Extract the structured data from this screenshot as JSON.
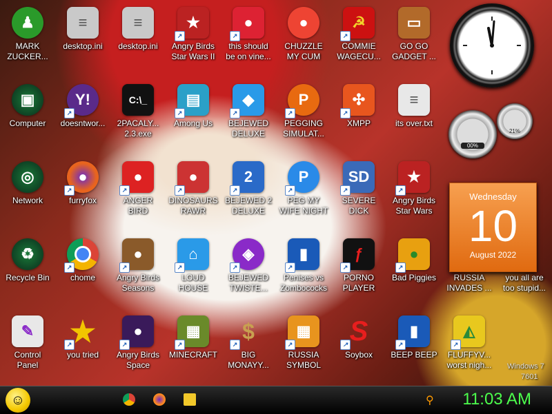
{
  "desktop": {
    "icons": [
      {
        "label": "MARK\nZUCKER...",
        "icon": "green-pawn-icon",
        "color": "#2a9a2a"
      },
      {
        "label": "desktop.ini",
        "icon": "document-icon",
        "color": "#c9c9c9"
      },
      {
        "label": "desktop.ini",
        "icon": "document-icon",
        "color": "#c9c9c9"
      },
      {
        "label": "Angry Birds\nStar Wars II",
        "icon": "angry-bird-icon",
        "color": "#b22"
      },
      {
        "label": "this should\nbe on vine...",
        "icon": "angry-bird-icon",
        "color": "#d23"
      },
      {
        "label": "CHUZZLE\nMY CUM",
        "icon": "chuzzle-icon",
        "color": "#e43"
      },
      {
        "label": "COMMIE\nWAGECU...",
        "icon": "hammer-sickle-icon",
        "color": "#c11"
      },
      {
        "label": "GO GO\nGADGET ...",
        "icon": "briefcase-icon",
        "color": "#b26a2a"
      },
      {
        "label": "Computer",
        "icon": "computer-icon",
        "color": "#135"
      },
      {
        "label": "doesntwor...",
        "icon": "yahoo-icon",
        "color": "#5a2a8a"
      },
      {
        "label": "2PACALY...\n2.3.exe",
        "icon": "console-icon",
        "color": "#111"
      },
      {
        "label": "Among Us",
        "icon": "among-us-icon",
        "color": "#2aa0c8"
      },
      {
        "label": "BEJEWED\nDELUXE",
        "icon": "gem-icon",
        "color": "#2a9ae8"
      },
      {
        "label": "PEGGING\nSIMULAT...",
        "icon": "peggle-icon",
        "color": "#e86a10"
      },
      {
        "label": "XMPP",
        "icon": "xmpp-icon",
        "color": "#e8561e"
      },
      {
        "label": "its over.txt",
        "icon": "text-file-icon",
        "color": "#e8e8e8"
      },
      {
        "label": "Network",
        "icon": "network-icon",
        "color": "#135"
      },
      {
        "label": "furryfox",
        "icon": "firefox-icon",
        "color": "#e8641e"
      },
      {
        "label": "ANGER\nBIRD",
        "icon": "angry-bird-icon",
        "color": "#d22"
      },
      {
        "label": "DINOSAURS\nRAWR",
        "icon": "angry-bird-icon",
        "color": "#c33"
      },
      {
        "label": "BEJEWED 2\nDELUXE",
        "icon": "bejeweled-2-icon",
        "color": "#2a6ac8"
      },
      {
        "label": "PEG MY\nWIFE NIGHT",
        "icon": "peggle-icon",
        "color": "#2a8ae8"
      },
      {
        "label": "SEVERE\nDICK",
        "icon": "sd-icon",
        "color": "#3a6ab8"
      },
      {
        "label": "Angry Birds\nStar Wars",
        "icon": "angry-bird-icon",
        "color": "#b22"
      },
      {
        "label": "Recycle Bin",
        "icon": "recycle-bin-icon",
        "color": "#135"
      },
      {
        "label": "chome",
        "icon": "chrome-icon",
        "color": "#fff"
      },
      {
        "label": "Angry Birds\nSeasons",
        "icon": "angry-bird-icon",
        "color": "#8a5a2a"
      },
      {
        "label": "LOUD\nHOUSE",
        "icon": "loud-house-icon",
        "color": "#2a9ae8"
      },
      {
        "label": "BEJEWED\nTWISTE...",
        "icon": "bejeweled-twist-icon",
        "color": "#8a2ac8"
      },
      {
        "label": "Penises vs\nZombococks",
        "icon": "blue-book-icon",
        "color": "#1a5ab8"
      },
      {
        "label": "PORNO\nPLAYER",
        "icon": "flash-icon",
        "color": "#111"
      },
      {
        "label": "Bad Piggies",
        "icon": "bad-piggies-icon",
        "color": "#e8a010"
      },
      {
        "label": "Control\nPanel",
        "icon": "control-panel-icon",
        "color": "#e8e8e8"
      },
      {
        "label": "you tried",
        "icon": "star-icon",
        "color": "#f2c400"
      },
      {
        "label": "Angry Birds\nSpace",
        "icon": "angry-bird-icon",
        "color": "#3a1a5a"
      },
      {
        "label": "MINECRAFT",
        "icon": "minecraft-icon",
        "color": "#6a8a2a"
      },
      {
        "label": "BIG\nMONAYY...",
        "icon": "money-bag-icon",
        "color": "#8a6a2a"
      },
      {
        "label": "RUSSIA\nSYMBOL",
        "icon": "orange-tiles-icon",
        "color": "#e8941e"
      },
      {
        "label": "Soybox",
        "icon": "s-logo-icon",
        "color": "#e81e1e"
      },
      {
        "label": "BEEP BEEP",
        "icon": "blue-book-icon",
        "color": "#1a5ab8"
      },
      {
        "label": "FLUFFYV...\nworst nigh...",
        "icon": "game-art-icon",
        "color": "#e8c81e"
      },
      {
        "label": "RUSSIA\nINVADES ...",
        "icon": "game-icon",
        "color": "#c83a1a"
      },
      {
        "label": "you all are\ntoo stupid...",
        "icon": "game-icon",
        "color": "#c82a1a"
      }
    ]
  },
  "gadgets": {
    "calendar": {
      "weekday": "Wednesday",
      "day": "10",
      "month_year": "August 2022"
    },
    "meter_cpu": "00%",
    "meter_mem": "21%"
  },
  "watermark": {
    "line1": "Windows 7",
    "line2": "7601"
  },
  "taskbar": {
    "clock": "11:03 AM",
    "pinned": [
      {
        "name": "chrome-taskbar-icon",
        "color": "#e8501e"
      },
      {
        "name": "firefox-taskbar-icon",
        "color": "#ff8a1e"
      },
      {
        "name": "explorer-taskbar-icon",
        "color": "#f2c82a"
      }
    ]
  }
}
